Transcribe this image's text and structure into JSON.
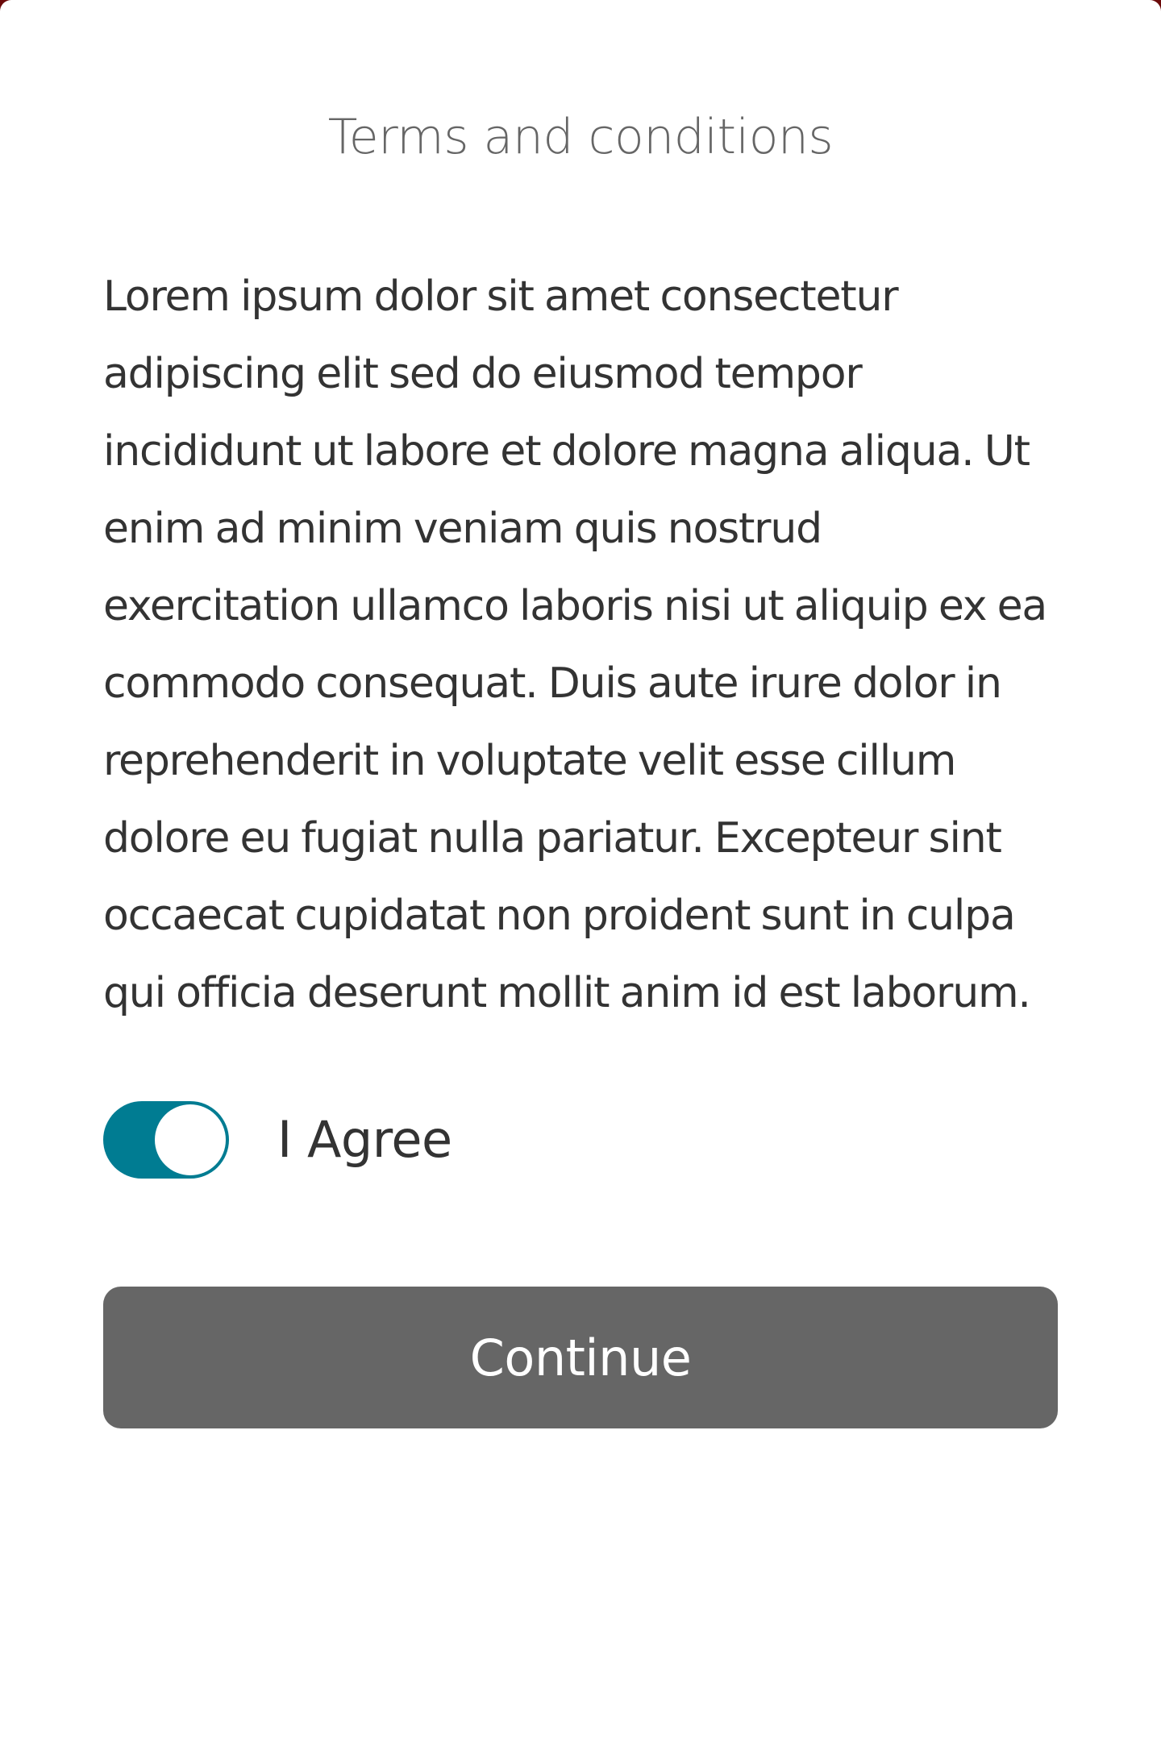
{
  "dialog": {
    "title": "Terms and conditions",
    "body": "Lorem ipsum dolor sit amet consectetur adipiscing elit sed do eiusmod tempor incididunt ut labore et dolore magna aliqua. Ut enim ad minim veniam quis nostrud exercitation ullamco laboris nisi ut aliquip ex ea commodo consequat. Duis aute irure dolor in reprehenderit in voluptate velit esse cillum dolore eu fugiat nulla pariatur. Excepteur sint occaecat cupidatat non proident sunt in culpa qui officia deserunt mollit anim id est laborum.",
    "agree_label": "I Agree",
    "agree_checked": true,
    "continue_label": "Continue"
  },
  "colors": {
    "toggle_on": "#007c92",
    "button_bg": "#666666",
    "title_text": "#666666",
    "body_text": "#333333"
  }
}
